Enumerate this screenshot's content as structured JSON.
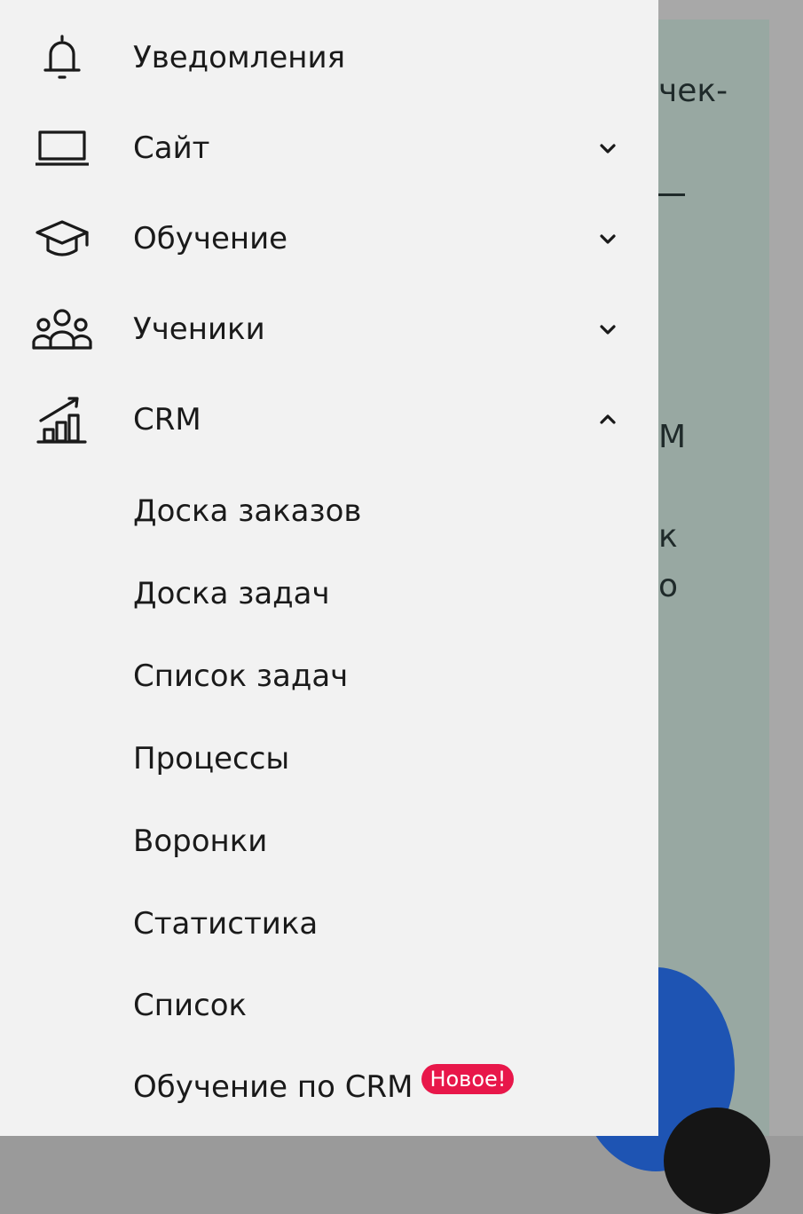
{
  "background": {
    "fragments": [
      "чек-",
      "М",
      "к",
      "о"
    ]
  },
  "menu": {
    "items": [
      {
        "label": "Уведомления",
        "icon": "bell-icon"
      },
      {
        "label": "Сайт",
        "icon": "laptop-icon",
        "chevron": "down"
      },
      {
        "label": "Обучение",
        "icon": "graduation-cap-icon",
        "chevron": "down"
      },
      {
        "label": "Ученики",
        "icon": "users-icon",
        "chevron": "down"
      },
      {
        "label": "CRM",
        "icon": "chart-growth-icon",
        "chevron": "up"
      }
    ],
    "crm_subitems": [
      "Доска заказов",
      "Доска задач",
      "Список задач",
      "Процессы",
      "Воронки",
      "Статистика",
      "Список",
      "Обучение по CRM"
    ],
    "new_badge": "Новое!"
  },
  "colors": {
    "drawer_bg": "#f2f2f2",
    "badge_bg": "#e8174a",
    "backdrop_card": "#98a8a2",
    "fab_blue": "#1e54b3"
  }
}
